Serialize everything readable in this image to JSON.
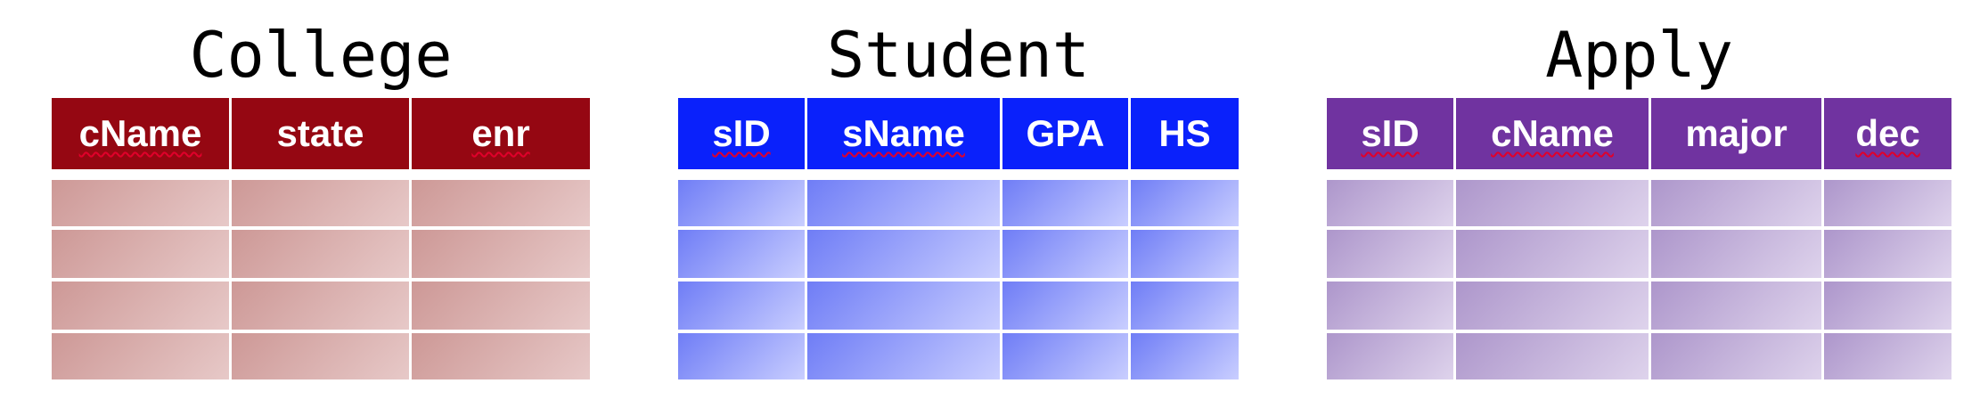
{
  "tables": [
    {
      "title": "College",
      "columns": [
        "cName",
        "state",
        "enr"
      ],
      "spellflag": [
        true,
        false,
        true
      ],
      "header_color": "#950712",
      "row_count": 4
    },
    {
      "title": "Student",
      "columns": [
        "sID",
        "sName",
        "GPA",
        "HS"
      ],
      "spellflag": [
        true,
        true,
        false,
        false
      ],
      "header_color": "#0a21fb",
      "row_count": 4
    },
    {
      "title": "Apply",
      "columns": [
        "sID",
        "cName",
        "major",
        "dec"
      ],
      "spellflag": [
        true,
        true,
        false,
        true
      ],
      "header_color": "#7033a0",
      "row_count": 4
    }
  ]
}
